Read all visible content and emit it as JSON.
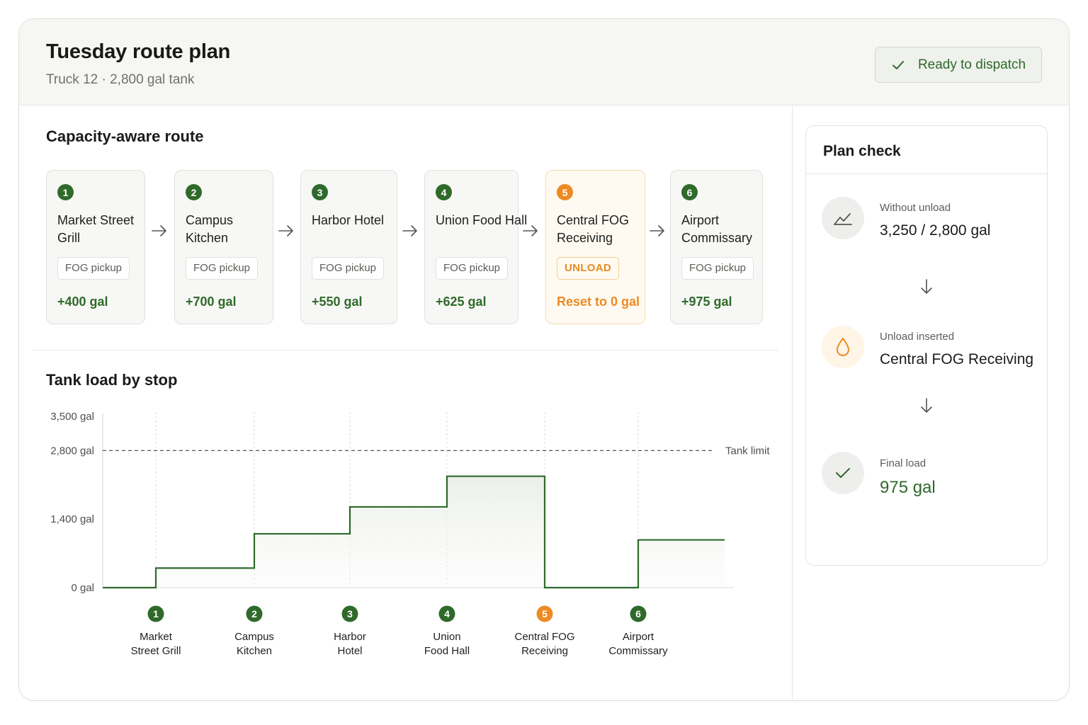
{
  "header": {
    "title": "Tuesday route plan",
    "subtitle": "Truck 12 · 2,800 gal tank",
    "dispatch_label": "Ready to dispatch"
  },
  "route": {
    "section_title": "Capacity-aware route",
    "stops": [
      {
        "num": "1",
        "name": "Market Street Grill",
        "tag": "FOG pickup",
        "gal": "+400 gal",
        "type": "pickup"
      },
      {
        "num": "2",
        "name": "Campus Kitchen",
        "tag": "FOG pickup",
        "gal": "+700 gal",
        "type": "pickup"
      },
      {
        "num": "3",
        "name": "Harbor Hotel",
        "tag": "FOG pickup",
        "gal": "+550 gal",
        "type": "pickup"
      },
      {
        "num": "4",
        "name": "Union Food Hall",
        "tag": "FOG pickup",
        "gal": "+625 gal",
        "type": "pickup"
      },
      {
        "num": "5",
        "name": "Central FOG Receiving",
        "tag": "UNLOAD",
        "gal": "Reset to 0 gal",
        "type": "unload"
      },
      {
        "num": "6",
        "name": "Airport Commissary",
        "tag": "FOG pickup",
        "gal": "+975 gal",
        "type": "pickup"
      }
    ]
  },
  "tank_chart": {
    "section_title": "Tank load by stop",
    "limit_label": "Tank limit"
  },
  "chart_data": {
    "type": "line",
    "title": "Tank load by stop",
    "step": true,
    "categories": [
      "Market Street Grill",
      "Campus Kitchen",
      "Harbor Hotel",
      "Union Food Hall",
      "Central FOG Receiving",
      "Airport Commissary"
    ],
    "category_numbers": [
      "1",
      "2",
      "3",
      "4",
      "5",
      "6"
    ],
    "values": [
      400,
      1100,
      1650,
      2275,
      0,
      975
    ],
    "ylim": [
      0,
      3500
    ],
    "yticks": [
      0,
      1400,
      2800,
      3500
    ],
    "ytick_labels": [
      "0 gal",
      "1,400 gal",
      "2,800 gal",
      "3,500 gal"
    ],
    "reference_line": {
      "value": 2800,
      "label": "Tank limit"
    },
    "colors": {
      "line": "#2f6a2b",
      "unload": "#ec8a23",
      "limit": "#555555"
    }
  },
  "plan_check": {
    "title": "Plan check",
    "items": [
      {
        "label": "Without unload",
        "value": "3,250 / 2,800 gal",
        "icon": "trend-up-icon"
      },
      {
        "label": "Unload inserted",
        "value": "Central FOG Receiving",
        "icon": "drop-icon"
      },
      {
        "label": "Final load",
        "value": "975 gal",
        "icon": "check-icon"
      }
    ]
  },
  "colors": {
    "accent_green": "#2f6a2b",
    "accent_orange": "#ec8a23",
    "header_bg": "#f6f6f3"
  }
}
